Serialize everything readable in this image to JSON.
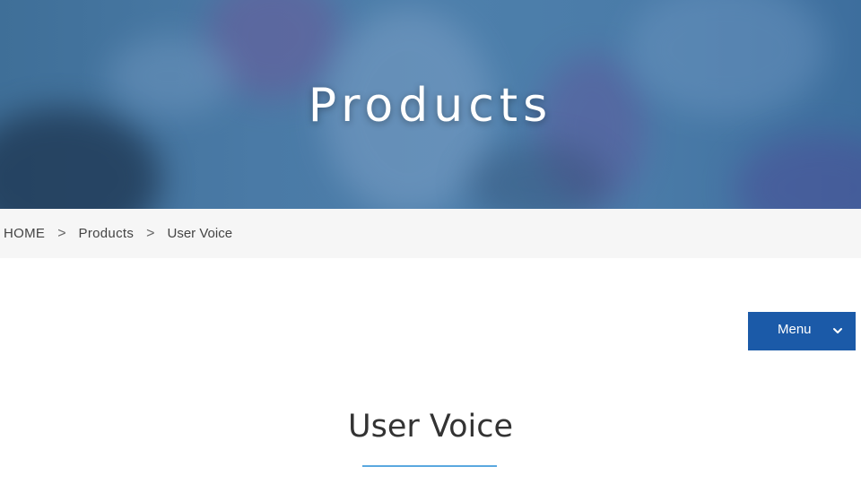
{
  "hero": {
    "title": "Products"
  },
  "breadcrumb": {
    "items": [
      {
        "label": "HOME"
      },
      {
        "label": "Products"
      },
      {
        "label": "User Voice"
      }
    ],
    "separator": ">"
  },
  "menu": {
    "label": "Menu",
    "icon": "chevron-down-icon"
  },
  "section": {
    "title": "User Voice"
  },
  "colors": {
    "accent": "#1b5aa8",
    "underline": "#5aa8df",
    "breadcrumb_bg": "#f6f6f6"
  }
}
